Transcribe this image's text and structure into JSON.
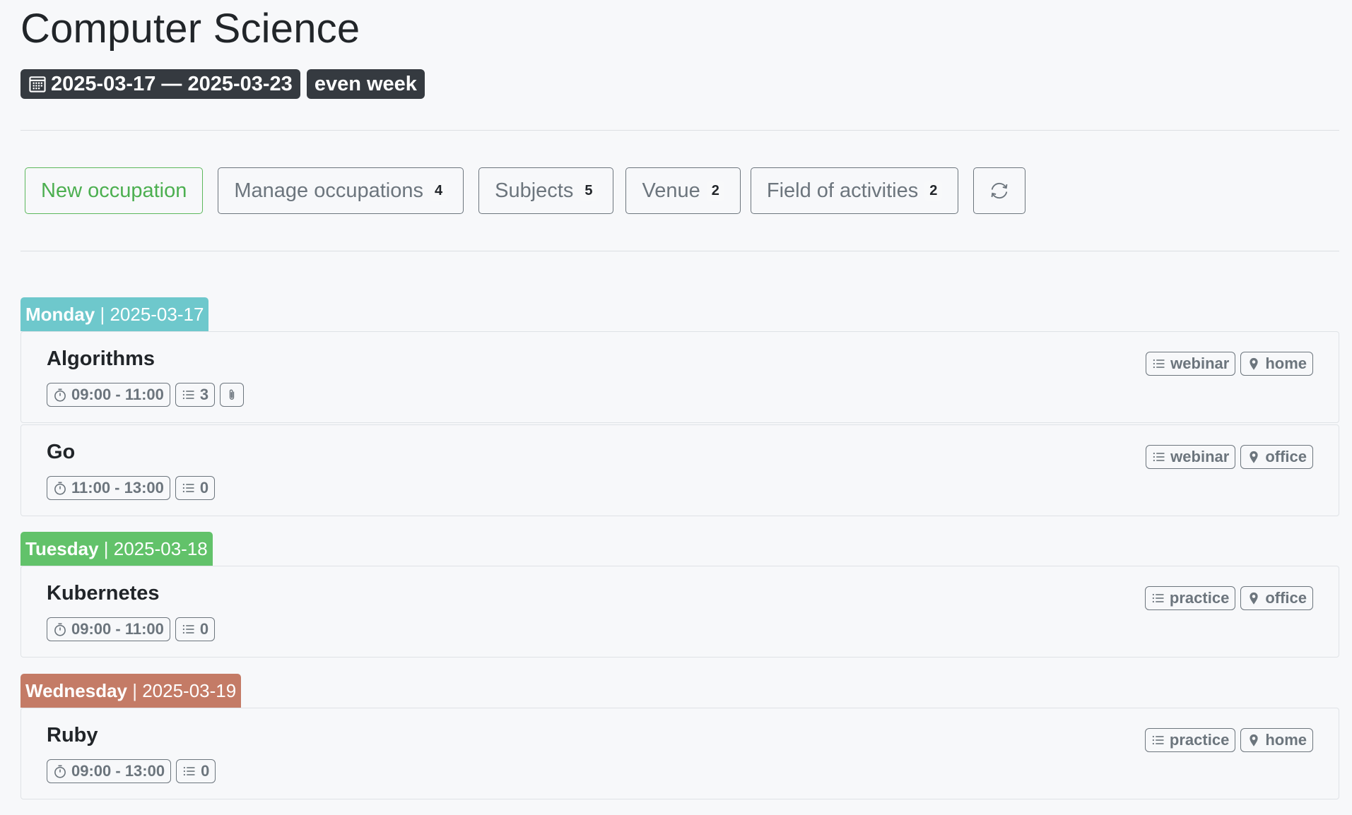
{
  "header": {
    "title": "Computer Science",
    "date_range": "2025-03-17 — 2025-03-23",
    "week_type": "even week"
  },
  "toolbar": {
    "new_occupation": "New occupation",
    "manage_occupations": "Manage occupations",
    "manage_occupations_count": "4",
    "subjects": "Subjects",
    "subjects_count": "5",
    "venue": "Venue",
    "venue_count": "2",
    "field_of_activities": "Field of activities",
    "field_of_activities_count": "2"
  },
  "days": [
    {
      "name": "Monday",
      "separator": " | ",
      "date": "2025-03-17",
      "color": "#6ec8cc",
      "items": [
        {
          "title": "Algorithms",
          "time": "09:00 - 11:00",
          "count": "3",
          "type": "webinar",
          "place": "home",
          "attachment": true
        },
        {
          "title": "Go",
          "time": "11:00 - 13:00",
          "count": "0",
          "type": "webinar",
          "place": "office"
        }
      ]
    },
    {
      "name": "Tuesday",
      "separator": " | ",
      "date": "2025-03-18",
      "color": "#62c26a",
      "items": [
        {
          "title": "Kubernetes",
          "time": "09:00 - 11:00",
          "count": "0",
          "type": "practice",
          "place": "office"
        }
      ]
    },
    {
      "name": "Wednesday",
      "separator": " | ",
      "date": "2025-03-19",
      "color": "#c47b66",
      "items": [
        {
          "title": "Ruby",
          "time": "09:00 - 13:00",
          "count": "0",
          "type": "practice",
          "place": "home"
        }
      ]
    }
  ],
  "icons": {
    "calendar": "calendar-icon",
    "refresh": "refresh-icon",
    "timer": "stopwatch-icon",
    "list": "list-icon",
    "attachment": "paperclip-icon",
    "location": "map-pin-icon"
  }
}
